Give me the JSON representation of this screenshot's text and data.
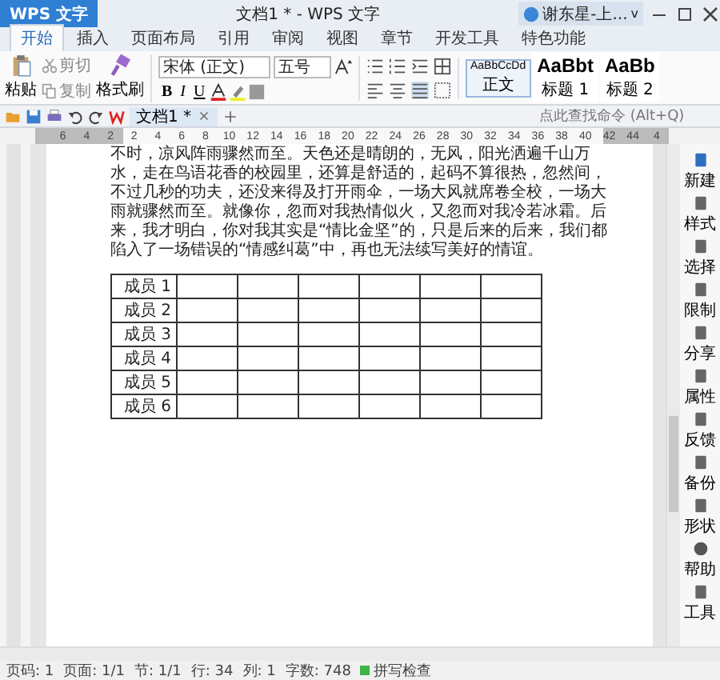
{
  "app_menu": {
    "label": "WPS 文字"
  },
  "window": {
    "title": "文档1 * - WPS 文字",
    "user": "谢东星-上...",
    "user_caret": "v"
  },
  "ribbon_tabs": [
    {
      "label": "开始",
      "selected": true
    },
    {
      "label": "插入",
      "selected": false
    },
    {
      "label": "页面布局",
      "selected": false
    },
    {
      "label": "引用",
      "selected": false
    },
    {
      "label": "审阅",
      "selected": false
    },
    {
      "label": "视图",
      "selected": false
    },
    {
      "label": "章节",
      "selected": false
    },
    {
      "label": "开发工具",
      "selected": false
    },
    {
      "label": "特色功能",
      "selected": false
    }
  ],
  "clipboard": {
    "paste": "粘贴",
    "cut": "剪切",
    "copy": "复制",
    "format_painter": "格式刷"
  },
  "font": {
    "family": "宋体 (正文)",
    "size": "五号",
    "format_buttons": [
      "B",
      "I",
      "U"
    ]
  },
  "styles": [
    {
      "preview": "AaBbCcDd",
      "name": "正文",
      "selected": true
    },
    {
      "preview": "AaBbt",
      "name": "标题 1",
      "selected": false
    },
    {
      "preview": "AaBb",
      "name": "标题 2",
      "selected": false
    }
  ],
  "document_tabs": [
    {
      "label": "文档1 *",
      "selected": true
    }
  ],
  "command_search": {
    "placeholder": "点此查找命令 (Alt+Q)"
  },
  "ruler_labels": [
    "6",
    "4",
    "2",
    "2",
    "4",
    "6",
    "8",
    "10",
    "12",
    "14",
    "16",
    "18",
    "20",
    "22",
    "24",
    "26",
    "28",
    "30",
    "32",
    "34",
    "36",
    "38",
    "40",
    "42",
    "44",
    "4"
  ],
  "document": {
    "paragraph": "不时，凉风阵雨骤然而至。天色还是晴朗的，无风，阳光洒遍千山万水，走在鸟语花香的校园里，还算是舒适的，起码不算很热，忽然间，不过几秒的功夫，还没来得及打开雨伞，一场大风就席卷全校，一场大雨就骤然而至。就像你，忽而对我热情似火，又忽而对我冷若冰霜。后来，我才明白，你对我其实是“情比金坚”的，只是后来的后来，我们都陷入了一场错误的“情感纠葛”中，再也无法续写美好的情谊。",
    "table": {
      "rows": [
        {
          "label": "成员 1"
        },
        {
          "label": "成员 2"
        },
        {
          "label": "成员 3"
        },
        {
          "label": "成员 4"
        },
        {
          "label": "成员 5"
        },
        {
          "label": "成员 6"
        }
      ]
    }
  },
  "sidebar": [
    {
      "label": "新建"
    },
    {
      "label": "样式"
    },
    {
      "label": "选择"
    },
    {
      "label": "限制"
    },
    {
      "label": "分享"
    },
    {
      "label": "属性"
    },
    {
      "label": "反馈"
    },
    {
      "label": "备份"
    },
    {
      "label": "形状"
    },
    {
      "label": "帮助"
    },
    {
      "label": "工具"
    }
  ],
  "status_bar": [
    "页码: 1",
    "页面: 1/1",
    "节: 1/1",
    "行: 34",
    "列: 1",
    "字数: 748"
  ],
  "spell_check": {
    "label": "拼写检查",
    "on": true
  }
}
